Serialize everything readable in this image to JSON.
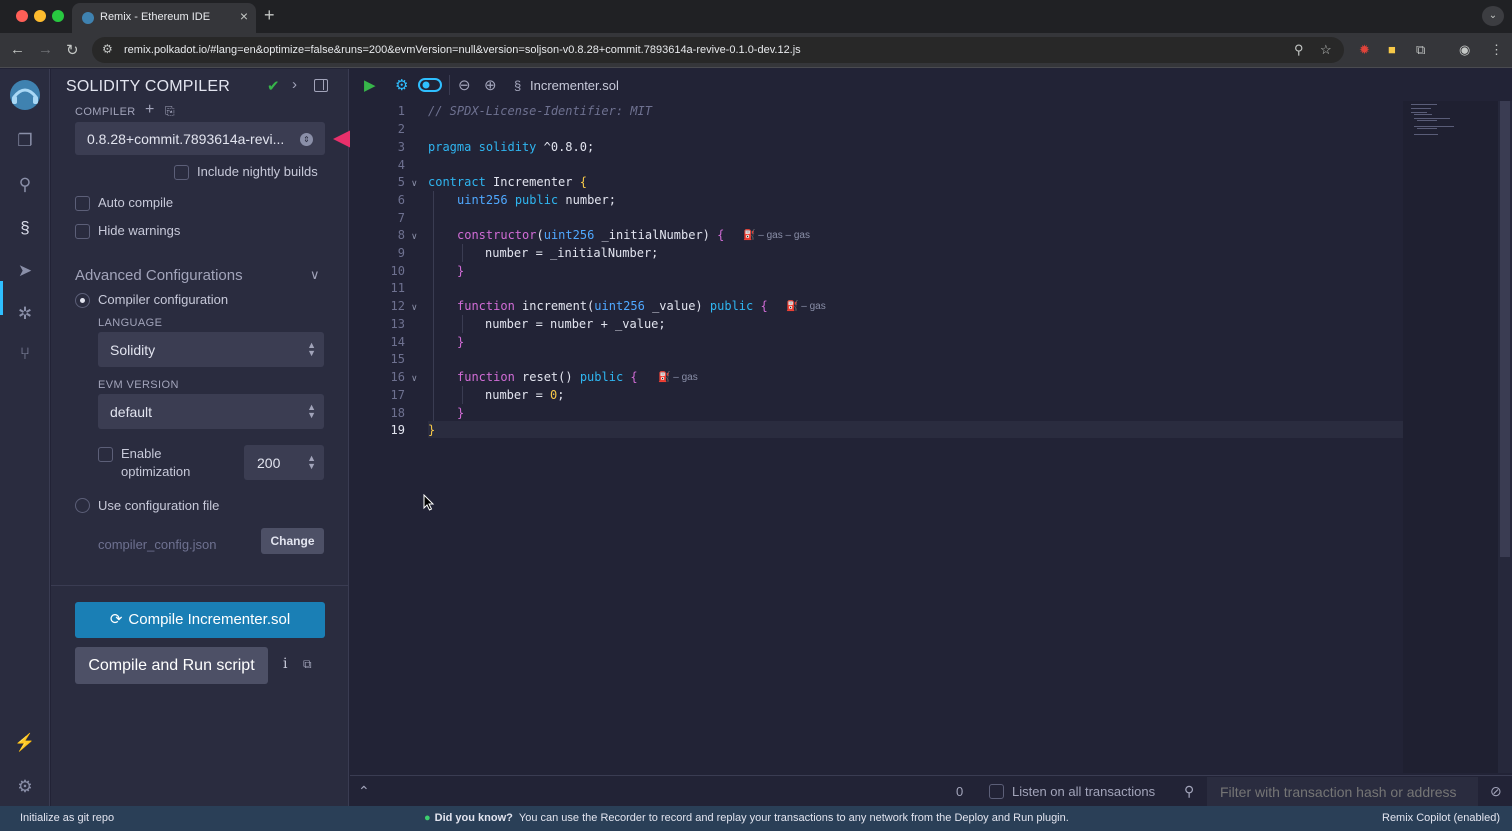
{
  "browser": {
    "tab_title": "Remix - Ethereum IDE",
    "url": "remix.polkadot.io/#lang=en&optimize=false&runs=200&evmVersion=null&version=soljson-v0.8.28+commit.7893614a-revive-0.1.0-dev.12.js"
  },
  "panel": {
    "title": "SOLIDITY COMPILER",
    "compiler_label": "COMPILER",
    "compiler_version": "0.8.28+commit.7893614a-revi...",
    "include_nightly": "Include nightly builds",
    "auto_compile": "Auto compile",
    "hide_warnings": "Hide warnings",
    "advanced_title": "Advanced Configurations",
    "compiler_configuration": "Compiler configuration",
    "language_label": "LANGUAGE",
    "language_value": "Solidity",
    "evm_label": "EVM VERSION",
    "evm_value": "default",
    "enable_optimization_1": "Enable",
    "enable_optimization_2": "optimization",
    "runs_value": "200",
    "use_config_file": "Use configuration file",
    "config_file_name": "compiler_config.json",
    "change_button": "Change",
    "compile_button": "Compile Incrementer.sol",
    "compile_run_button": "Compile and Run script",
    "info_icon": "i"
  },
  "editor": {
    "file_name": "Incrementer.sol",
    "line_numbers": [
      "1",
      "2",
      "3",
      "4",
      "5",
      "6",
      "7",
      "8",
      "9",
      "10",
      "11",
      "12",
      "13",
      "14",
      "15",
      "16",
      "17",
      "18",
      "19"
    ],
    "gas_constructor": "– gas – gas",
    "gas_increment": "– gas",
    "gas_reset": "– gas"
  },
  "terminal": {
    "count": "0",
    "listen_label": "Listen on all transactions",
    "filter_placeholder": "Filter with transaction hash or address"
  },
  "statusbar": {
    "left": "Initialize as git repo",
    "tip_title": "Did you know?",
    "tip_text": "You can use the Recorder to record and replay your transactions to any network from the Deploy and Run plugin.",
    "right": "Remix Copilot (enabled)"
  },
  "colors": {
    "accent": "#1a7fb5",
    "annotation_arrow": "#e8306b",
    "success": "#37b54a"
  }
}
